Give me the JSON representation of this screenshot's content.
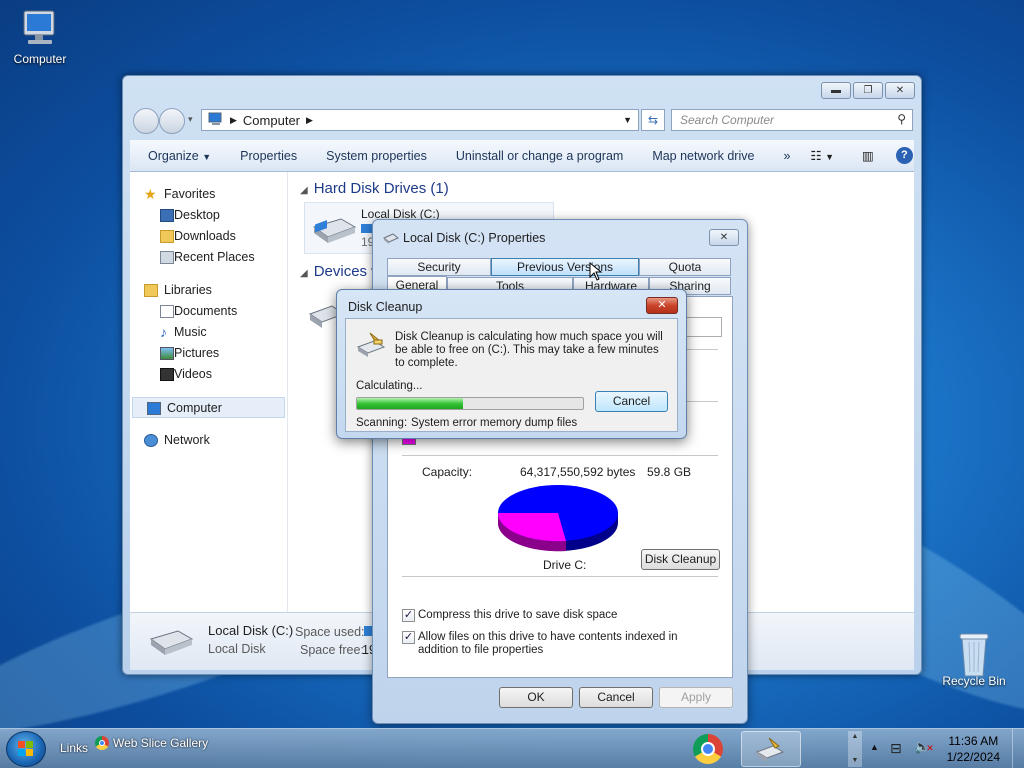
{
  "desktop": {
    "icons": [
      {
        "label": "Computer"
      },
      {
        "label": "Recycle Bin"
      }
    ]
  },
  "explorer": {
    "address": {
      "location": "Computer"
    },
    "search": {
      "placeholder": "Search Computer"
    },
    "commands": [
      "Organize",
      "Properties",
      "System properties",
      "Uninstall or change a program",
      "Map network drive",
      "»"
    ],
    "nav": {
      "favorites": "Favorites",
      "fav_items": [
        "Desktop",
        "Downloads",
        "Recent Places"
      ],
      "libraries": "Libraries",
      "lib_items": [
        "Documents",
        "Music",
        "Pictures",
        "Videos"
      ],
      "computer": "Computer",
      "network": "Network"
    },
    "groups": {
      "hdd": "Hard Disk Drives (1)",
      "devices": "Devices w"
    },
    "drive_item": {
      "name": "Local Disk (C:)",
      "size_frag": "19"
    },
    "details": {
      "name": "Local Disk (C:)",
      "type": "Local Disk",
      "space_used_label": "Space used:",
      "space_free_label": "Space free:",
      "space_free_frag": "19"
    }
  },
  "properties": {
    "title": "Local Disk (C:) Properties",
    "tabs_row1": [
      "Security",
      "Previous Versions",
      "Quota"
    ],
    "tabs_row2": [
      "General",
      "Tools",
      "Hardware",
      "Sharing"
    ],
    "capacity_label": "Capacity:",
    "capacity_bytes": "64,317,550,592 bytes",
    "capacity_gb": "59.8 GB",
    "drive_label": "Drive C:",
    "disk_cleanup_button": "Disk Cleanup",
    "compress_label": "Compress this drive to save disk space",
    "compress_checked": true,
    "index_label": "Allow files on this drive to have contents indexed in addition to file properties",
    "index_checked": true,
    "buttons": {
      "ok": "OK",
      "cancel": "Cancel",
      "apply": "Apply"
    },
    "pie": {
      "used_color": "#ff00ff",
      "free_color": "#0000ff"
    }
  },
  "cleanup": {
    "title": "Disk Cleanup",
    "message": "Disk Cleanup is calculating how much space you will be able to free on  (C:). This may take a few minutes to complete.",
    "calculating": "Calculating...",
    "cancel": "Cancel",
    "progress": 0.47,
    "scanning_label": "Scanning:",
    "scanning_item": "System error memory dump files"
  },
  "taskbar": {
    "links_label": "Links",
    "web_slice": "Web Slice Gallery",
    "time": "11:36 AM",
    "date": "1/22/2024"
  }
}
